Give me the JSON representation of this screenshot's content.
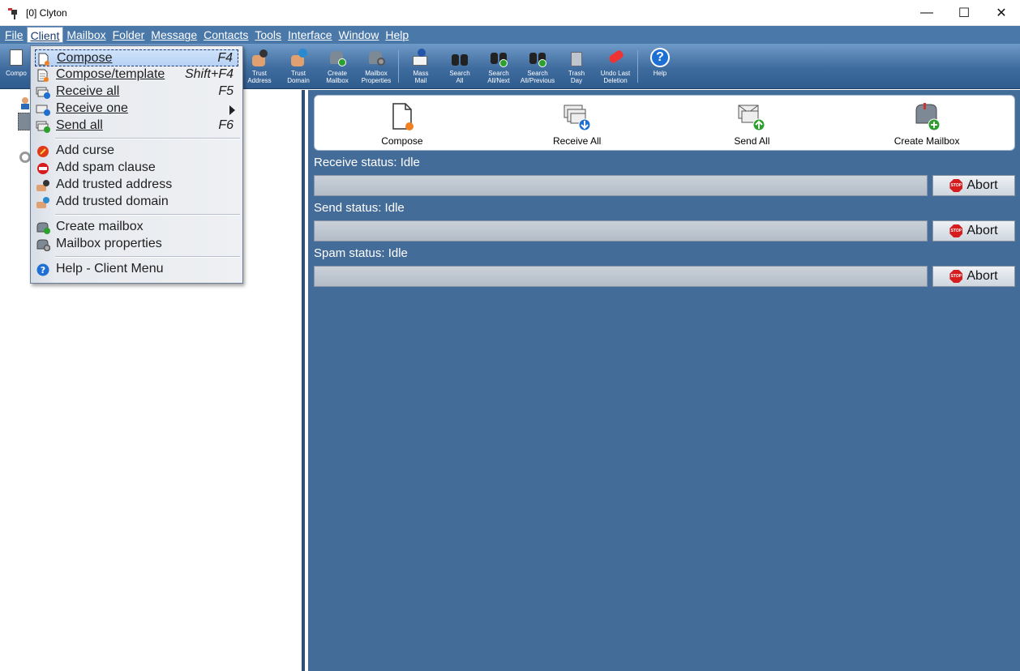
{
  "window": {
    "title": "[0] Clyton",
    "controls": {
      "minimize": "—",
      "maximize": "☐",
      "close": "✕"
    }
  },
  "menubar": {
    "items": [
      "File",
      "Client",
      "Mailbox",
      "Folder",
      "Message",
      "Contacts",
      "Tools",
      "Interface",
      "Window",
      "Help"
    ],
    "active": "Client"
  },
  "toolbar": {
    "items": [
      {
        "label": "Compo",
        "icon": "compose-icon"
      },
      {
        "label": "Trust\nAddress",
        "icon": "trust-address-icon"
      },
      {
        "label": "Trust\nDomain",
        "icon": "trust-domain-icon"
      },
      {
        "label": "Create\nMailbox",
        "icon": "create-mailbox-icon"
      },
      {
        "label": "Mailbox\nProperties",
        "icon": "mailbox-properties-icon"
      },
      {
        "label": "Mass\nMail",
        "icon": "mass-mail-icon"
      },
      {
        "label": "Search\nAll",
        "icon": "binoculars-icon"
      },
      {
        "label": "Search\nAll/Next",
        "icon": "binoculars-next-icon"
      },
      {
        "label": "Search\nAll/Previous",
        "icon": "binoculars-previous-icon"
      },
      {
        "label": "Trash\nDay",
        "icon": "trash-icon"
      },
      {
        "label": "Undo Last\nDeletion",
        "icon": "eraser-icon"
      },
      {
        "label": "Help",
        "icon": "help-icon"
      }
    ]
  },
  "client_menu": {
    "groups": [
      [
        {
          "label": "Compose",
          "shortcut": "F4",
          "icon": "compose-icon",
          "selected": true
        },
        {
          "label": "Compose/template",
          "shortcut": "Shift+F4",
          "icon": "compose-template-icon"
        },
        {
          "label": "Receive all",
          "shortcut": "F5",
          "icon": "receive-all-icon"
        },
        {
          "label": "Receive one",
          "shortcut": "",
          "icon": "receive-one-icon",
          "submenu": true
        },
        {
          "label": "Send all",
          "shortcut": "F6",
          "icon": "send-all-icon"
        }
      ],
      [
        {
          "label": "Add curse",
          "icon": "curse-icon"
        },
        {
          "label": "Add spam clause",
          "icon": "spam-clause-icon"
        },
        {
          "label": "Add trusted address",
          "icon": "trusted-address-icon"
        },
        {
          "label": "Add trusted domain",
          "icon": "trusted-domain-icon"
        }
      ],
      [
        {
          "label": "Create mailbox",
          "icon": "create-mailbox-icon"
        },
        {
          "label": "Mailbox properties",
          "icon": "mailbox-properties-icon"
        }
      ],
      [
        {
          "label": "Help - Client Menu",
          "icon": "help-icon"
        }
      ]
    ]
  },
  "quickbar": {
    "compose": "Compose",
    "receive_all": "Receive All",
    "send_all": "Send All",
    "create_mailbox": "Create Mailbox"
  },
  "status": {
    "receive": "Receive status: Idle",
    "send": "Send status: Idle",
    "spam": "Spam status: Idle",
    "abort_label": "Abort",
    "stop_text": "STOP"
  },
  "colors": {
    "menubar_bg": "#4a78a8",
    "pane_bg": "#446c99",
    "toolbar_top": "#6f9ac8",
    "toolbar_bottom": "#2f5c8e"
  }
}
